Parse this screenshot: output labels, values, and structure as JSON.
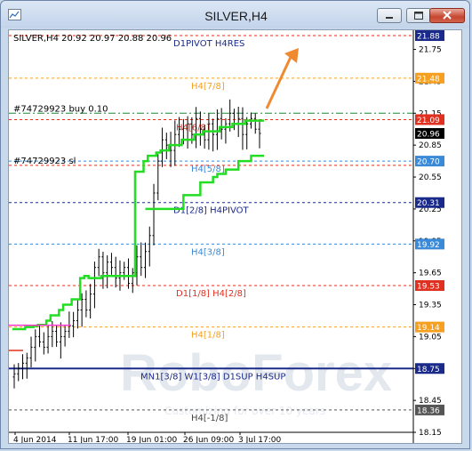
{
  "window": {
    "title": "SILVER,H4"
  },
  "chart_data": {
    "type": "candlestick",
    "symbol": "SILVER,H4",
    "ohlc_header": "SILVER,H4  20.92 20.97 20.88 20.96",
    "ylim": [
      18.15,
      21.88
    ],
    "y_ticks": [
      18.15,
      18.45,
      18.75,
      19.05,
      19.35,
      19.65,
      19.95,
      20.25,
      20.55,
      20.85,
      21.15,
      21.45,
      21.75
    ],
    "x_ticks": [
      "4 Jun 2014",
      "11 Jun 17:00",
      "19 Jun 01:00",
      "26 Jun 09:00",
      "3 Jul 17:00"
    ],
    "current_price": 20.96,
    "levels": [
      {
        "label": "D1PIVOT H4RES",
        "value": 21.88,
        "color": "#e03020",
        "style": "dashed",
        "text_color": "#1a2a8a"
      },
      {
        "label": "H4[7/8]",
        "value": 21.48,
        "color": "#f5a020",
        "style": "dashed",
        "text_color": "#f5a020"
      },
      {
        "label": "#74729923 buy 0.10",
        "value": 21.15,
        "color": "#1a8a3a",
        "style": "dashdot",
        "text_color": "#000000"
      },
      {
        "label": "H4[6/8]",
        "value": 21.09,
        "color": "#e03020",
        "style": "dashed",
        "text_color": "#e03020"
      },
      {
        "label": "H4[5/8]",
        "value": 20.7,
        "color": "#3a8ad8",
        "style": "dashed",
        "text_color": "#3a8ad8"
      },
      {
        "label": "#74729923 sl",
        "value": 20.66,
        "color": "#e03020",
        "style": "dashed",
        "text_color": "#000000"
      },
      {
        "label": "D1[2/8] H4PIVOT",
        "value": 20.31,
        "color": "#1a2a8a",
        "style": "dashed",
        "text_color": "#1a2a8a"
      },
      {
        "label": "H4[3/8]",
        "value": 19.92,
        "color": "#3a8ad8",
        "style": "dashed",
        "text_color": "#3a8ad8"
      },
      {
        "label": "D1[1/8] H4[2/8]",
        "value": 19.53,
        "color": "#e03020",
        "style": "dashed",
        "text_color": "#e03020"
      },
      {
        "label": "H4[1/8]",
        "value": 19.14,
        "color": "#f5a020",
        "style": "dashed",
        "text_color": "#f5a020"
      },
      {
        "label": "MN1[3/8] W1[3/8] D1SUP H4SUP",
        "value": 18.75,
        "color": "#1a2a8a",
        "style": "solid",
        "text_color": "#1a2a8a"
      },
      {
        "label": "H4[-1/8]",
        "value": 18.36,
        "color": "#555555",
        "style": "dashed",
        "text_color": "#444444"
      }
    ],
    "price_labels": [
      {
        "text": "21.88",
        "bg": "#1a2a8a"
      },
      {
        "text": "21.48",
        "bg": "#f5a020"
      },
      {
        "text": "21.09",
        "bg": "#e03020"
      },
      {
        "text": "20.96",
        "bg": "#000000"
      },
      {
        "text": "20.70",
        "bg": "#3a8ad8"
      },
      {
        "text": "20.31",
        "bg": "#1a2a8a"
      },
      {
        "text": "19.92",
        "bg": "#3a8ad8"
      },
      {
        "text": "19.53",
        "bg": "#e03020"
      },
      {
        "text": "19.14",
        "bg": "#f5a020"
      },
      {
        "text": "18.75",
        "bg": "#1a2a8a"
      },
      {
        "text": "18.36",
        "bg": "#555555"
      }
    ],
    "price_path": [
      18.7,
      18.75,
      18.8,
      18.85,
      18.95,
      19.05,
      19.0,
      18.95,
      19.05,
      19.1,
      19.0,
      19.05,
      19.1,
      19.15,
      19.2,
      19.3,
      19.4,
      19.3,
      19.45,
      19.7,
      19.8,
      19.65,
      19.75,
      19.7,
      19.6,
      19.65,
      19.7,
      19.55,
      19.65,
      19.8,
      19.7,
      19.85,
      20.0,
      20.4,
      20.7,
      20.9,
      20.85,
      20.8,
      20.95,
      21.0,
      20.9,
      21.05,
      20.95,
      21.1,
      21.0,
      20.9,
      21.05,
      20.95,
      21.1,
      21.0,
      21.05,
      21.15,
      21.05,
      21.1,
      20.95,
      21.05,
      21.1,
      21.0,
      20.96
    ],
    "trail_stop": [
      19.12,
      19.12,
      19.12,
      19.14,
      19.14,
      19.15,
      19.16,
      19.16,
      19.2,
      19.25,
      19.25,
      19.3,
      19.35,
      19.35,
      19.4,
      19.4,
      19.6,
      19.62,
      19.6,
      19.6,
      19.6,
      19.62,
      19.62,
      19.62,
      19.62,
      19.62,
      19.62,
      19.62,
      19.62,
      20.6,
      20.6,
      20.7,
      20.75,
      20.75,
      20.78,
      20.8,
      20.8,
      20.85,
      20.85,
      20.85,
      20.9,
      20.9,
      20.9,
      20.95,
      20.95,
      20.98,
      20.98,
      20.98,
      20.98,
      21.02,
      21.02,
      21.02,
      21.05,
      21.05,
      21.05,
      21.08,
      21.08,
      21.08,
      21.08
    ],
    "second_line": [
      20.25,
      20.25,
      20.25,
      20.25,
      20.25,
      20.25,
      20.25,
      20.25,
      20.25,
      20.38,
      20.38,
      20.38,
      20.38,
      20.5,
      20.5,
      20.5,
      20.55,
      20.58,
      20.58,
      20.62,
      20.62,
      20.62,
      20.7,
      20.7,
      20.7,
      20.75,
      20.75
    ],
    "watermark": "RoboForex",
    "watermark_sub": "Customizing for over 10 years"
  }
}
